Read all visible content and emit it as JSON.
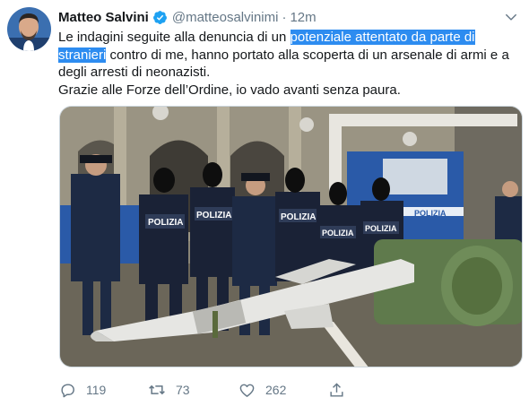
{
  "tweet": {
    "display_name": "Matteo Salvini",
    "handle": "@matteosalvinimi",
    "separator": "·",
    "time": "12m",
    "text_line1_pre": "Le indagini seguite alla denuncia di un ",
    "text_highlight": "potenziale attentato da parte di stranieri",
    "text_line1_post": " contro di me, hanno portato alla scoperta di un arsenale di armi e a degli arresti di neonazisti.",
    "text_line2": "Grazie alle Forze dell’Ordine, io vado avanti senza paura.",
    "media_signs": {
      "polizia": "POLIZIA",
      "vehicle": "POLIZIA"
    },
    "actions": {
      "reply_count": "119",
      "retweet_count": "73",
      "like_count": "262"
    },
    "colors": {
      "highlight": "#2d8cf0",
      "verified": "#1da1f2",
      "muted": "#657786"
    }
  }
}
